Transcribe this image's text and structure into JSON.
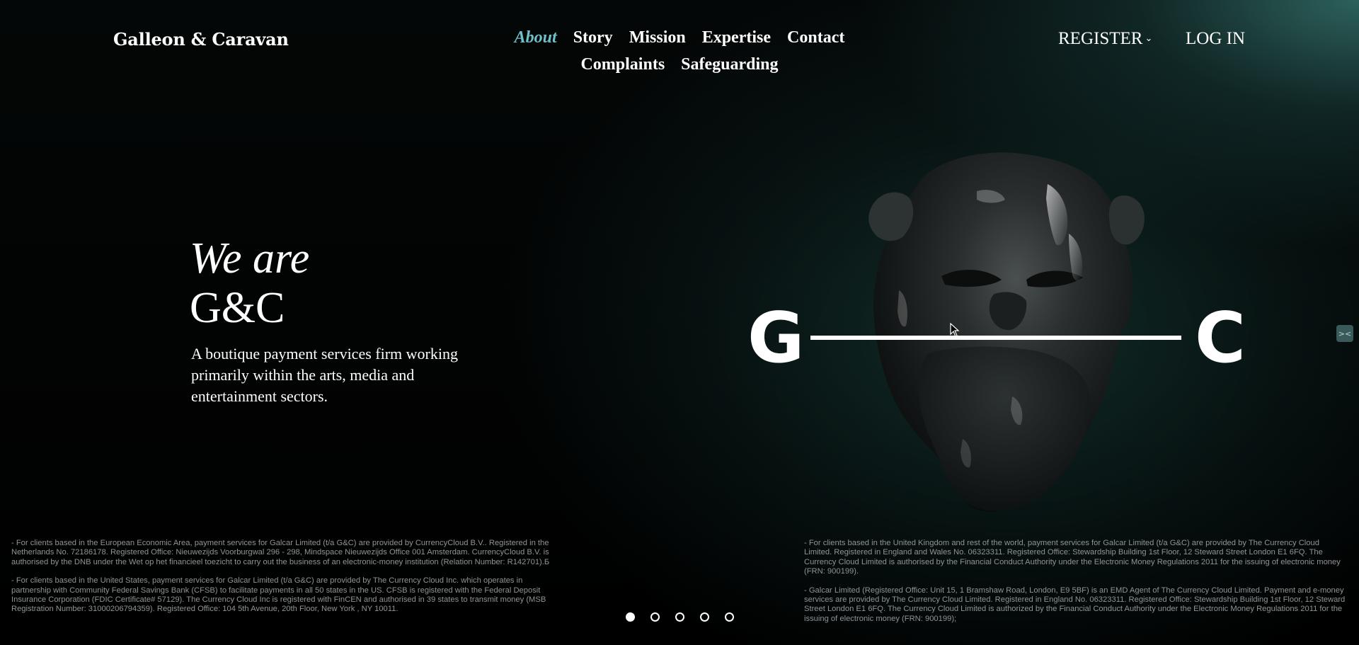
{
  "brand": {
    "name": "Galleon & Caravan"
  },
  "nav": {
    "items": [
      {
        "label": "About",
        "active": true
      },
      {
        "label": "Story",
        "active": false
      },
      {
        "label": "Mission",
        "active": false
      },
      {
        "label": "Expertise",
        "active": false
      },
      {
        "label": "Contact",
        "active": false
      },
      {
        "label": "Complaints",
        "active": false
      },
      {
        "label": "Safeguarding",
        "active": false
      }
    ],
    "active_color": "#6ec1c8"
  },
  "auth": {
    "register_label": "REGISTER",
    "register_icon": "chevron-down-icon",
    "login_label": "LOG IN"
  },
  "hero": {
    "title_line1": "We are",
    "title_line2": "G&C",
    "subtitle": "A boutique payment services firm working primarily within the arts, media and entertainment sectors."
  },
  "graphic": {
    "left_letter": "G",
    "right_letter": "C",
    "sculpture_icon": "lion-head-sculpture"
  },
  "disclaimers": {
    "left": [
      "- For clients based in the European Economic Area, payment services for Galcar Limited (t/a G&C) are provided by CurrencyCloud B.V.. Registered in the Netherlands No. 72186178. Registered Office: Nieuwezijds Voorburgwal 296 - 298, Mindspace Nieuwezijds Office 001 Amsterdam. CurrencyCloud B.V. is authorised by the DNB under the Wet op het financieel toezicht to carry out the business of an electronic-money institution (Relation Number: R142701).Б",
      "- For clients based in the United States, payment services for Galcar Limited (t/a G&C) are provided by The Currency Cloud Inc. which operates in partnership with Community Federal Savings Bank (CFSB) to facilitate payments in all 50 states in the US. CFSB is registered with the Federal Deposit Insurance Corporation (FDIC Certificate# 57129). The Currency Cloud Inc is registered with FinCEN and authorised in 39 states to transmit money (MSB Registration Number: 31000206794359). Registered Office: 104 5th Avenue, 20th Floor, New York , NY 10011."
    ],
    "right": [
      "- For clients based in the United Kingdom and rest of the world, payment services for Galcar Limited (t/a G&C) are provided by The Currency Cloud Limited. Registered in England and Wales No. 06323311. Registered Office: Stewardship Building 1st Floor, 12 Steward Street London E1 6FQ. The Currency Cloud Limited is authorised by the Financial Conduct Authority under the Electronic Money Regulations 2011 for the issuing of electronic money (FRN: 900199).",
      "- Galcar Limited (Registered Office: Unit 15, 1 Bramshaw Road, London, E9 5BF) is an EMD Agent of The Currency Cloud Limited. Payment and e-money services are provided by The Currency Cloud Limited. Registered in England No. 06323311. Registered Office: Stewardship Building 1st Floor, 12 Steward Street London E1 6FQ. The Currency Cloud Limited is authorized by the Financial Conduct Authority under the Electronic Money Regulations 2011 for the issuing of electronic money (FRN: 900199);"
    ]
  },
  "pager": {
    "total": 5,
    "active_index": 0
  }
}
